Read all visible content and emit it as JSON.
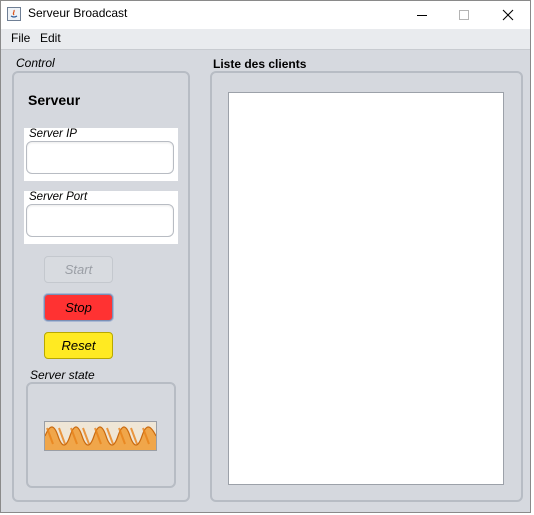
{
  "window": {
    "title": "Serveur Broadcast"
  },
  "menu": {
    "items": [
      "File",
      "Edit"
    ]
  },
  "control": {
    "group_label": "Control",
    "heading": "Serveur",
    "server_ip": {
      "label": "Server IP",
      "value": ""
    },
    "server_port": {
      "label": "Server Port",
      "value": ""
    },
    "buttons": {
      "start": "Start",
      "stop": "Stop",
      "reset": "Reset"
    },
    "state_label": "Server state",
    "state_icon": "orange-wave-icon"
  },
  "clients": {
    "label": "Liste des clients",
    "items": []
  },
  "colors": {
    "window_bg": "#d6d9df",
    "stop_button": "#ff3232",
    "reset_button": "#ffea22",
    "wave": "#e8821a"
  }
}
